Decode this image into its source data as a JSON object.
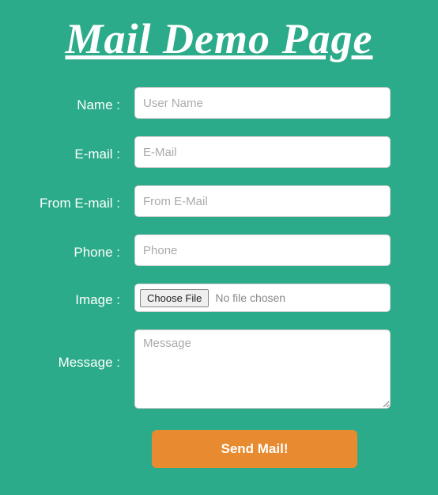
{
  "title": "Mail Demo Page",
  "form": {
    "name": {
      "label": "Name :",
      "placeholder": "User Name"
    },
    "email": {
      "label": "E-mail :",
      "placeholder": "E-Mail"
    },
    "from_email": {
      "label": "From E-mail :",
      "placeholder": "From E-Mail"
    },
    "phone": {
      "label": "Phone :",
      "placeholder": "Phone"
    },
    "image": {
      "label": "Image :",
      "button": "Choose File",
      "status": "No file chosen"
    },
    "message": {
      "label": "Message :",
      "placeholder": "Message"
    },
    "submit": "Send Mail!"
  }
}
